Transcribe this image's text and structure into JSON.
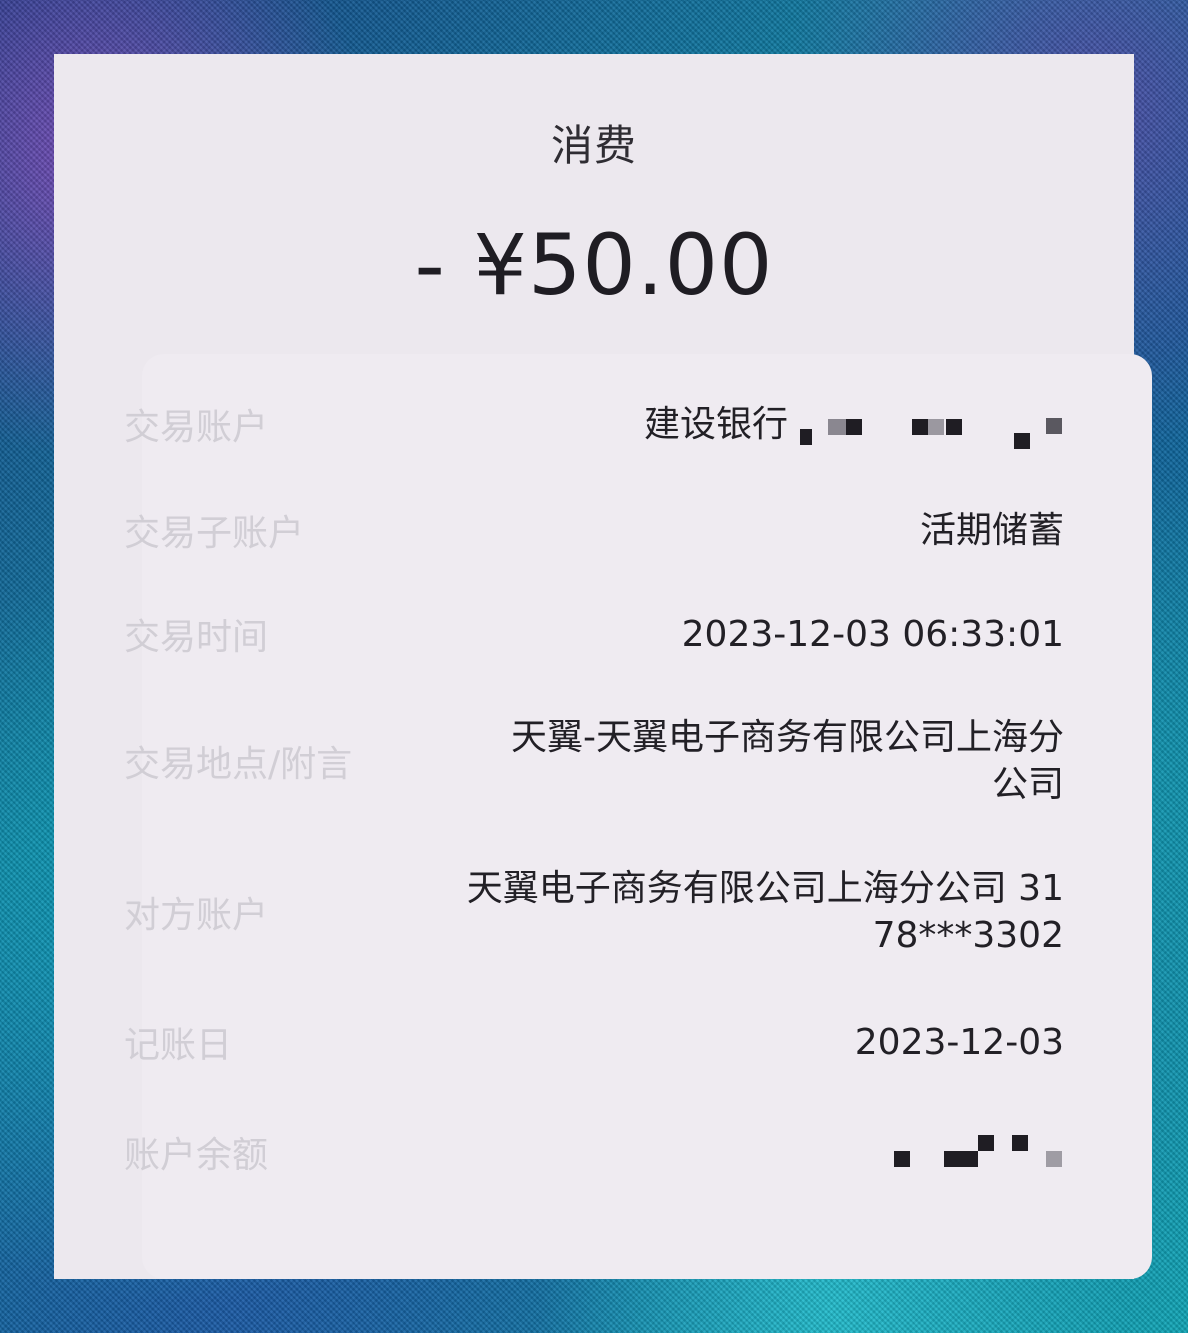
{
  "header": {
    "title": "消费",
    "amount": "- ¥50.00"
  },
  "details": [
    {
      "label": "交易账户",
      "value": "建设银行"
    },
    {
      "label": "交易子账户",
      "value": "活期储蓄"
    },
    {
      "label": "交易时间",
      "value": "2023-12-03 06:33:01"
    },
    {
      "label": "交易地点/附言",
      "value": "天翼-天翼电子商务有限公司上海分\n公司"
    },
    {
      "label": "对方账户",
      "value": "天翼电子商务有限公司上海分公司 31\n78***3302"
    },
    {
      "label": "记账日",
      "value": "2023-12-03"
    },
    {
      "label": "账户余额",
      "value": ""
    }
  ]
}
